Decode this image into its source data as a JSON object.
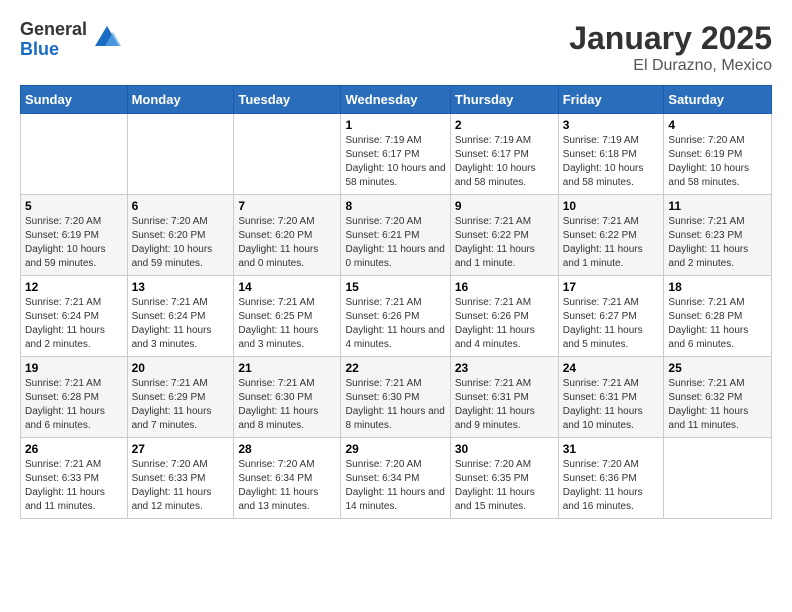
{
  "header": {
    "logo_general": "General",
    "logo_blue": "Blue",
    "title": "January 2025",
    "subtitle": "El Durazno, Mexico"
  },
  "days_of_week": [
    "Sunday",
    "Monday",
    "Tuesday",
    "Wednesday",
    "Thursday",
    "Friday",
    "Saturday"
  ],
  "weeks": [
    [
      {
        "day": "",
        "info": ""
      },
      {
        "day": "",
        "info": ""
      },
      {
        "day": "",
        "info": ""
      },
      {
        "day": "1",
        "info": "Sunrise: 7:19 AM\nSunset: 6:17 PM\nDaylight: 10 hours and 58 minutes."
      },
      {
        "day": "2",
        "info": "Sunrise: 7:19 AM\nSunset: 6:17 PM\nDaylight: 10 hours and 58 minutes."
      },
      {
        "day": "3",
        "info": "Sunrise: 7:19 AM\nSunset: 6:18 PM\nDaylight: 10 hours and 58 minutes."
      },
      {
        "day": "4",
        "info": "Sunrise: 7:20 AM\nSunset: 6:19 PM\nDaylight: 10 hours and 58 minutes."
      }
    ],
    [
      {
        "day": "5",
        "info": "Sunrise: 7:20 AM\nSunset: 6:19 PM\nDaylight: 10 hours and 59 minutes."
      },
      {
        "day": "6",
        "info": "Sunrise: 7:20 AM\nSunset: 6:20 PM\nDaylight: 10 hours and 59 minutes."
      },
      {
        "day": "7",
        "info": "Sunrise: 7:20 AM\nSunset: 6:20 PM\nDaylight: 11 hours and 0 minutes."
      },
      {
        "day": "8",
        "info": "Sunrise: 7:20 AM\nSunset: 6:21 PM\nDaylight: 11 hours and 0 minutes."
      },
      {
        "day": "9",
        "info": "Sunrise: 7:21 AM\nSunset: 6:22 PM\nDaylight: 11 hours and 1 minute."
      },
      {
        "day": "10",
        "info": "Sunrise: 7:21 AM\nSunset: 6:22 PM\nDaylight: 11 hours and 1 minute."
      },
      {
        "day": "11",
        "info": "Sunrise: 7:21 AM\nSunset: 6:23 PM\nDaylight: 11 hours and 2 minutes."
      }
    ],
    [
      {
        "day": "12",
        "info": "Sunrise: 7:21 AM\nSunset: 6:24 PM\nDaylight: 11 hours and 2 minutes."
      },
      {
        "day": "13",
        "info": "Sunrise: 7:21 AM\nSunset: 6:24 PM\nDaylight: 11 hours and 3 minutes."
      },
      {
        "day": "14",
        "info": "Sunrise: 7:21 AM\nSunset: 6:25 PM\nDaylight: 11 hours and 3 minutes."
      },
      {
        "day": "15",
        "info": "Sunrise: 7:21 AM\nSunset: 6:26 PM\nDaylight: 11 hours and 4 minutes."
      },
      {
        "day": "16",
        "info": "Sunrise: 7:21 AM\nSunset: 6:26 PM\nDaylight: 11 hours and 4 minutes."
      },
      {
        "day": "17",
        "info": "Sunrise: 7:21 AM\nSunset: 6:27 PM\nDaylight: 11 hours and 5 minutes."
      },
      {
        "day": "18",
        "info": "Sunrise: 7:21 AM\nSunset: 6:28 PM\nDaylight: 11 hours and 6 minutes."
      }
    ],
    [
      {
        "day": "19",
        "info": "Sunrise: 7:21 AM\nSunset: 6:28 PM\nDaylight: 11 hours and 6 minutes."
      },
      {
        "day": "20",
        "info": "Sunrise: 7:21 AM\nSunset: 6:29 PM\nDaylight: 11 hours and 7 minutes."
      },
      {
        "day": "21",
        "info": "Sunrise: 7:21 AM\nSunset: 6:30 PM\nDaylight: 11 hours and 8 minutes."
      },
      {
        "day": "22",
        "info": "Sunrise: 7:21 AM\nSunset: 6:30 PM\nDaylight: 11 hours and 8 minutes."
      },
      {
        "day": "23",
        "info": "Sunrise: 7:21 AM\nSunset: 6:31 PM\nDaylight: 11 hours and 9 minutes."
      },
      {
        "day": "24",
        "info": "Sunrise: 7:21 AM\nSunset: 6:31 PM\nDaylight: 11 hours and 10 minutes."
      },
      {
        "day": "25",
        "info": "Sunrise: 7:21 AM\nSunset: 6:32 PM\nDaylight: 11 hours and 11 minutes."
      }
    ],
    [
      {
        "day": "26",
        "info": "Sunrise: 7:21 AM\nSunset: 6:33 PM\nDaylight: 11 hours and 11 minutes."
      },
      {
        "day": "27",
        "info": "Sunrise: 7:20 AM\nSunset: 6:33 PM\nDaylight: 11 hours and 12 minutes."
      },
      {
        "day": "28",
        "info": "Sunrise: 7:20 AM\nSunset: 6:34 PM\nDaylight: 11 hours and 13 minutes."
      },
      {
        "day": "29",
        "info": "Sunrise: 7:20 AM\nSunset: 6:34 PM\nDaylight: 11 hours and 14 minutes."
      },
      {
        "day": "30",
        "info": "Sunrise: 7:20 AM\nSunset: 6:35 PM\nDaylight: 11 hours and 15 minutes."
      },
      {
        "day": "31",
        "info": "Sunrise: 7:20 AM\nSunset: 6:36 PM\nDaylight: 11 hours and 16 minutes."
      },
      {
        "day": "",
        "info": ""
      }
    ]
  ]
}
